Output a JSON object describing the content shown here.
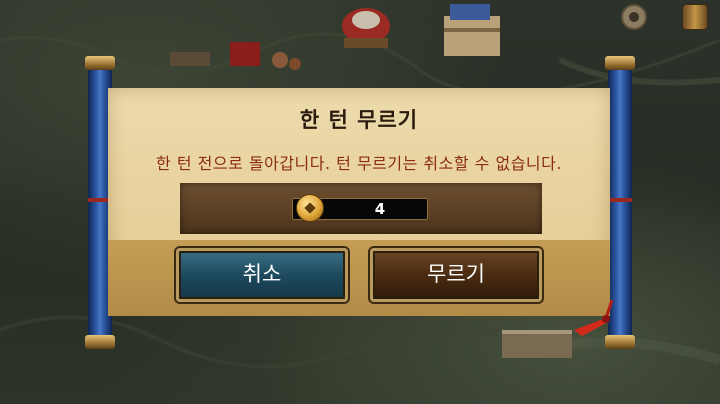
{
  "dialog": {
    "title": "한 턴 무르기",
    "message": "한 턴 전으로 돌아갑니다. 턴 무르기는 취소할 수 없습니다.",
    "cost": {
      "icon": "gold-coin-icon",
      "value": "4"
    },
    "buttons": {
      "cancel_label": "취소",
      "undo_label": "무르기"
    }
  },
  "top_bar": {
    "icons": [
      "gear-icon",
      "spool-icon"
    ]
  },
  "colors": {
    "parchment": "#e8d29e",
    "title_text": "#2a1b0e",
    "message_text": "#8a2b12",
    "cancel_button": "#1e4a5e",
    "undo_button": "#4a2c12",
    "scroll_rod": "#2e5aa8"
  }
}
